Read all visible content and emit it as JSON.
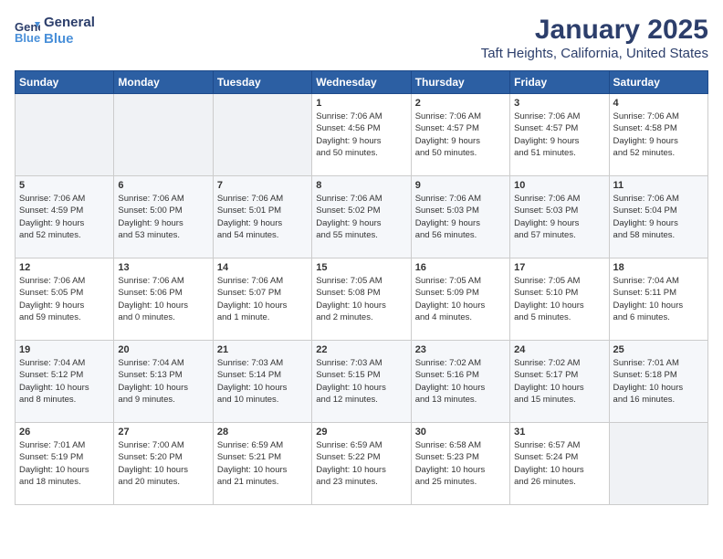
{
  "logo": {
    "line1": "General",
    "line2": "Blue"
  },
  "title": "January 2025",
  "location": "Taft Heights, California, United States",
  "weekdays": [
    "Sunday",
    "Monday",
    "Tuesday",
    "Wednesday",
    "Thursday",
    "Friday",
    "Saturday"
  ],
  "weeks": [
    [
      {
        "day": "",
        "info": ""
      },
      {
        "day": "",
        "info": ""
      },
      {
        "day": "",
        "info": ""
      },
      {
        "day": "1",
        "info": "Sunrise: 7:06 AM\nSunset: 4:56 PM\nDaylight: 9 hours\nand 50 minutes."
      },
      {
        "day": "2",
        "info": "Sunrise: 7:06 AM\nSunset: 4:57 PM\nDaylight: 9 hours\nand 50 minutes."
      },
      {
        "day": "3",
        "info": "Sunrise: 7:06 AM\nSunset: 4:57 PM\nDaylight: 9 hours\nand 51 minutes."
      },
      {
        "day": "4",
        "info": "Sunrise: 7:06 AM\nSunset: 4:58 PM\nDaylight: 9 hours\nand 52 minutes."
      }
    ],
    [
      {
        "day": "5",
        "info": "Sunrise: 7:06 AM\nSunset: 4:59 PM\nDaylight: 9 hours\nand 52 minutes."
      },
      {
        "day": "6",
        "info": "Sunrise: 7:06 AM\nSunset: 5:00 PM\nDaylight: 9 hours\nand 53 minutes."
      },
      {
        "day": "7",
        "info": "Sunrise: 7:06 AM\nSunset: 5:01 PM\nDaylight: 9 hours\nand 54 minutes."
      },
      {
        "day": "8",
        "info": "Sunrise: 7:06 AM\nSunset: 5:02 PM\nDaylight: 9 hours\nand 55 minutes."
      },
      {
        "day": "9",
        "info": "Sunrise: 7:06 AM\nSunset: 5:03 PM\nDaylight: 9 hours\nand 56 minutes."
      },
      {
        "day": "10",
        "info": "Sunrise: 7:06 AM\nSunset: 5:03 PM\nDaylight: 9 hours\nand 57 minutes."
      },
      {
        "day": "11",
        "info": "Sunrise: 7:06 AM\nSunset: 5:04 PM\nDaylight: 9 hours\nand 58 minutes."
      }
    ],
    [
      {
        "day": "12",
        "info": "Sunrise: 7:06 AM\nSunset: 5:05 PM\nDaylight: 9 hours\nand 59 minutes."
      },
      {
        "day": "13",
        "info": "Sunrise: 7:06 AM\nSunset: 5:06 PM\nDaylight: 10 hours\nand 0 minutes."
      },
      {
        "day": "14",
        "info": "Sunrise: 7:06 AM\nSunset: 5:07 PM\nDaylight: 10 hours\nand 1 minute."
      },
      {
        "day": "15",
        "info": "Sunrise: 7:05 AM\nSunset: 5:08 PM\nDaylight: 10 hours\nand 2 minutes."
      },
      {
        "day": "16",
        "info": "Sunrise: 7:05 AM\nSunset: 5:09 PM\nDaylight: 10 hours\nand 4 minutes."
      },
      {
        "day": "17",
        "info": "Sunrise: 7:05 AM\nSunset: 5:10 PM\nDaylight: 10 hours\nand 5 minutes."
      },
      {
        "day": "18",
        "info": "Sunrise: 7:04 AM\nSunset: 5:11 PM\nDaylight: 10 hours\nand 6 minutes."
      }
    ],
    [
      {
        "day": "19",
        "info": "Sunrise: 7:04 AM\nSunset: 5:12 PM\nDaylight: 10 hours\nand 8 minutes."
      },
      {
        "day": "20",
        "info": "Sunrise: 7:04 AM\nSunset: 5:13 PM\nDaylight: 10 hours\nand 9 minutes."
      },
      {
        "day": "21",
        "info": "Sunrise: 7:03 AM\nSunset: 5:14 PM\nDaylight: 10 hours\nand 10 minutes."
      },
      {
        "day": "22",
        "info": "Sunrise: 7:03 AM\nSunset: 5:15 PM\nDaylight: 10 hours\nand 12 minutes."
      },
      {
        "day": "23",
        "info": "Sunrise: 7:02 AM\nSunset: 5:16 PM\nDaylight: 10 hours\nand 13 minutes."
      },
      {
        "day": "24",
        "info": "Sunrise: 7:02 AM\nSunset: 5:17 PM\nDaylight: 10 hours\nand 15 minutes."
      },
      {
        "day": "25",
        "info": "Sunrise: 7:01 AM\nSunset: 5:18 PM\nDaylight: 10 hours\nand 16 minutes."
      }
    ],
    [
      {
        "day": "26",
        "info": "Sunrise: 7:01 AM\nSunset: 5:19 PM\nDaylight: 10 hours\nand 18 minutes."
      },
      {
        "day": "27",
        "info": "Sunrise: 7:00 AM\nSunset: 5:20 PM\nDaylight: 10 hours\nand 20 minutes."
      },
      {
        "day": "28",
        "info": "Sunrise: 6:59 AM\nSunset: 5:21 PM\nDaylight: 10 hours\nand 21 minutes."
      },
      {
        "day": "29",
        "info": "Sunrise: 6:59 AM\nSunset: 5:22 PM\nDaylight: 10 hours\nand 23 minutes."
      },
      {
        "day": "30",
        "info": "Sunrise: 6:58 AM\nSunset: 5:23 PM\nDaylight: 10 hours\nand 25 minutes."
      },
      {
        "day": "31",
        "info": "Sunrise: 6:57 AM\nSunset: 5:24 PM\nDaylight: 10 hours\nand 26 minutes."
      },
      {
        "day": "",
        "info": ""
      }
    ]
  ]
}
